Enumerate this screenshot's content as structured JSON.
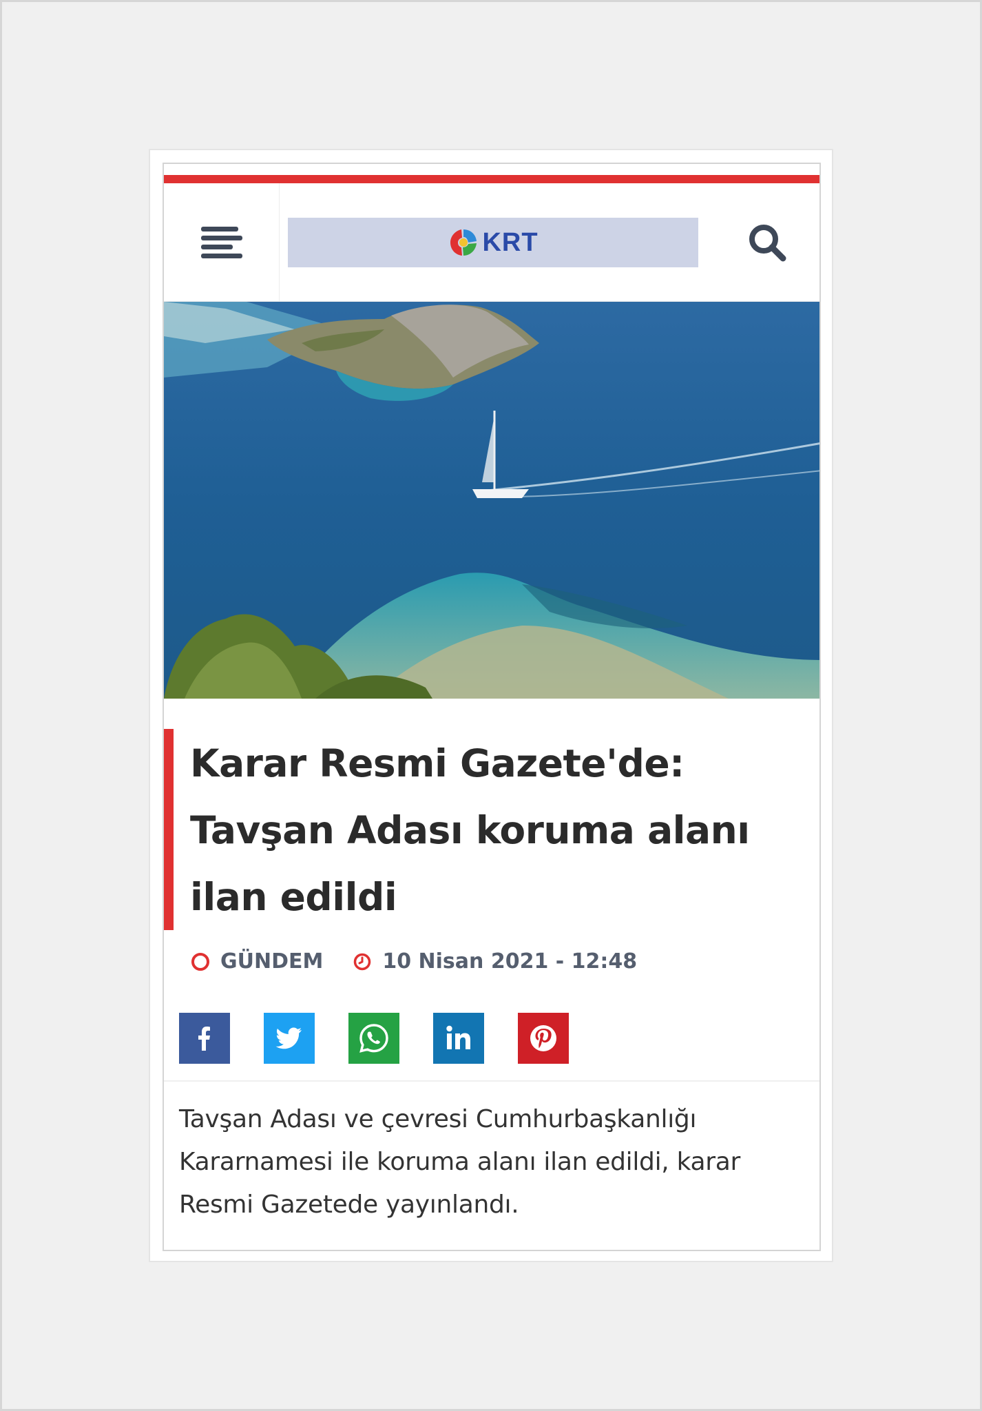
{
  "header": {
    "logo_text": "KRT",
    "menu_icon": "hamburger-menu-icon",
    "search_icon": "search-icon"
  },
  "article": {
    "title": "Karar Resmi Gazete'de: Tavşan Adası koruma alanı ilan edildi",
    "category": "GÜNDEM",
    "date": "10 Nisan 2021 - 12:48",
    "summary": "Tavşan Adası ve çevresi Cumhurbaşkanlığı Kararnamesi ile koruma alanı ilan edildi, karar Resmi Gazetede yayınlandı."
  },
  "share": [
    {
      "network": "facebook",
      "icon": "facebook-icon",
      "color": "#3b5a9c"
    },
    {
      "network": "twitter",
      "icon": "twitter-icon",
      "color": "#1da1f2"
    },
    {
      "network": "whatsapp",
      "icon": "whatsapp-icon",
      "color": "#25a244"
    },
    {
      "network": "linkedin",
      "icon": "linkedin-icon",
      "color": "#1275b2"
    },
    {
      "network": "pinterest",
      "icon": "pinterest-icon",
      "color": "#cf2027"
    }
  ],
  "colors": {
    "accent": "#e03131",
    "logo_bg": "#cdd3e6",
    "text": "#2b2b2b",
    "meta": "#555e6e"
  }
}
